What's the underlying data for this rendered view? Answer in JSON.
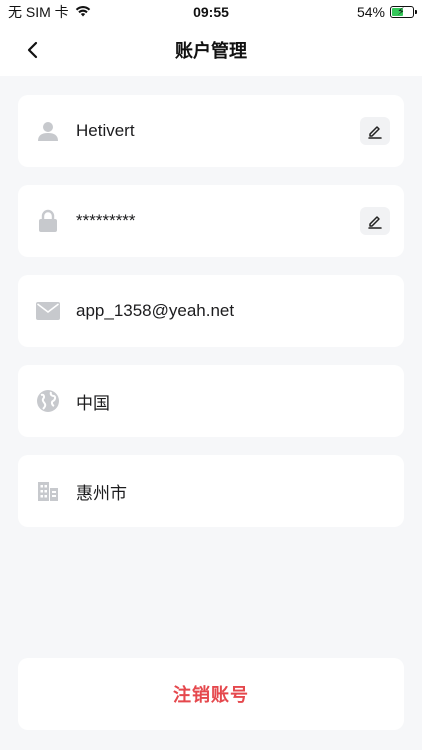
{
  "status_bar": {
    "carrier": "无 SIM 卡",
    "time": "09:55",
    "battery_percent": "54%",
    "battery_level": 0.54
  },
  "nav": {
    "title": "账户管理"
  },
  "fields": [
    {
      "value": "Hetivert",
      "icon": "person-icon",
      "editable": true
    },
    {
      "value": "*********",
      "icon": "lock-icon",
      "editable": true
    },
    {
      "value": "app_1358@yeah.net",
      "icon": "mail-icon",
      "editable": false
    },
    {
      "value": "中国",
      "icon": "globe-icon",
      "editable": false
    },
    {
      "value": "惠州市",
      "icon": "building-icon",
      "editable": false
    }
  ],
  "delete_account": {
    "label": "注销账号",
    "color": "#e5484d"
  },
  "colors": {
    "background": "#f6f7f9",
    "card": "#ffffff",
    "icon_gray": "#c7c9cd",
    "danger": "#e5484d"
  }
}
